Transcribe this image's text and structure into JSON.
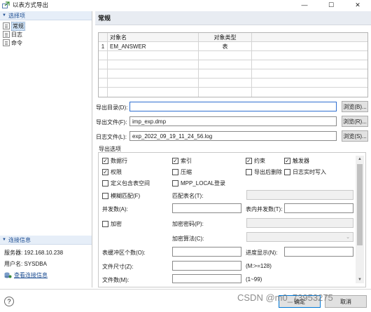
{
  "window": {
    "title": "以表方式导出",
    "minimize": "—",
    "maximize": "☐",
    "close": "✕"
  },
  "sidebar": {
    "select_header": "选择项",
    "items": [
      {
        "label": "常规",
        "selected": true
      },
      {
        "label": "日志",
        "selected": false
      },
      {
        "label": "命令",
        "selected": false
      }
    ],
    "conn_header": "连接信息",
    "server_label": "服务器: 192.168.10.238",
    "user_label": "用户名: SYSDBA",
    "view_link": "查看连接信息"
  },
  "panel": {
    "title": "常规",
    "table": {
      "columns": [
        "对象名",
        "对象类型"
      ],
      "rows": [
        {
          "num": "1",
          "name": "EM_ANSWER",
          "type": "表"
        }
      ]
    },
    "export_dir": {
      "label": "导出目录(D):",
      "value": "",
      "browse": "浏览(B)..."
    },
    "export_file": {
      "label": "导出文件(F):",
      "value": "imp_exp.dmp",
      "browse": "浏览(R)..."
    },
    "log_file": {
      "label": "日志文件(L):",
      "value": "exp_2022_09_19_11_24_56.log",
      "browse": "浏览(S)..."
    }
  },
  "options": {
    "header": "导出选项",
    "checks": {
      "data_rows": {
        "label": "数据行",
        "checked": true
      },
      "index": {
        "label": "索引",
        "checked": true
      },
      "constraint": {
        "label": "约束",
        "checked": true
      },
      "trigger": {
        "label": "触发器",
        "checked": true
      },
      "grant": {
        "label": "权限",
        "checked": true
      },
      "compress": {
        "label": "压缩",
        "checked": false
      },
      "drop_after": {
        "label": "导出后删除",
        "checked": false
      },
      "log_realtime": {
        "label": "日志实时写入",
        "checked": false
      },
      "tablespace": {
        "label": "定义包含表空间",
        "checked": false
      },
      "mpp_local": {
        "label": "MPP_LOCAL登录",
        "checked": false
      },
      "fuzzy": {
        "label": "模糊匹配(F)",
        "checked": false
      },
      "encrypt": {
        "label": "加密",
        "checked": false
      }
    },
    "match_table_label": "匹配表名(T):",
    "parallel_label": "并发数(A):",
    "table_parallel_label": "表内并发数(T):",
    "encrypt_pwd_label": "加密密码(P):",
    "encrypt_algo_label": "加密算法(C):",
    "buffer_label": "表缓冲区个数(O):",
    "progress_label": "进度显示(N):",
    "file_size_label": "文件尺寸(Z):",
    "file_size_hint": "(M:>=128)",
    "file_count_label": "文件数(M):",
    "file_count_hint": "(1~99)"
  },
  "footer": {
    "ok": "确定",
    "cancel": "取消",
    "help": "?"
  },
  "watermark": "CSDN @m0_73953275"
}
